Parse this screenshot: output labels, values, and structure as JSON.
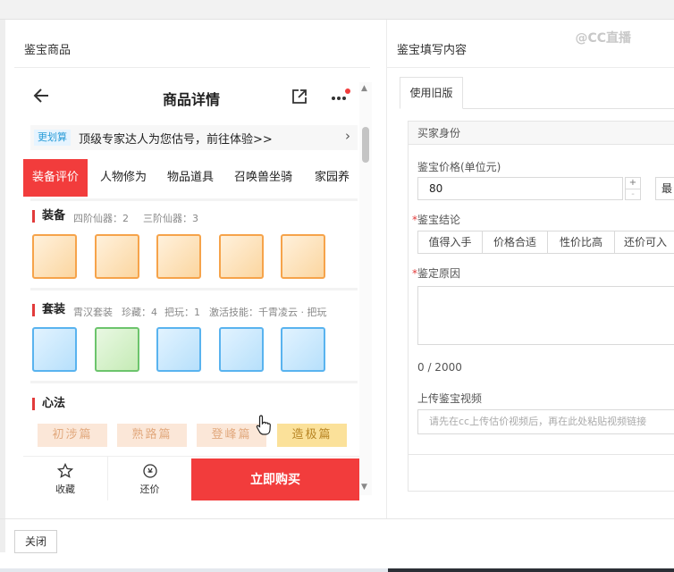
{
  "watermark": "@CC直播",
  "left_panel": {
    "title": "鉴宝商品"
  },
  "right_panel": {
    "title": "鉴宝填写内容"
  },
  "phone": {
    "title": "商品详情",
    "promo": {
      "badge": "更划算",
      "text": "顶级专家达人为您估号，前往体验>>",
      "chevron": "›"
    },
    "tabs": [
      "装备评价",
      "人物修为",
      "物品道具",
      "召唤兽坐骑",
      "家园养"
    ],
    "sections": {
      "equipment": {
        "title": "装备",
        "meta": [
          "四阶仙器：2",
          "三阶仙器：3"
        ]
      },
      "set": {
        "title": "套装",
        "meta": [
          "霄汉套装",
          "珍藏：4",
          "把玩：1",
          "激活技能：千霄凌云 · 把玩"
        ]
      },
      "xinfa": {
        "title": "心法",
        "items": [
          "初涉篇",
          "熟路篇",
          "登峰篇",
          "造极篇"
        ]
      }
    },
    "bottom_bar": {
      "favorite": "收藏",
      "bargain": "还价",
      "buy": "立即购买"
    }
  },
  "form": {
    "tab_label": "使用旧版",
    "section_title": "买家身份",
    "price_label": "鉴宝价格(单位元)",
    "price_value": "80",
    "price_extra": "最",
    "conclusion_label": "鉴宝结论",
    "conclusion_options": [
      "值得入手",
      "价格合适",
      "性价比高",
      "还价可入"
    ],
    "reason_label": "鉴定原因",
    "char_count": "0 / 2000",
    "video_label": "上传鉴宝视频",
    "video_placeholder": "请先在cc上传估价视频后，再在此处粘贴视频链接"
  },
  "footer": {
    "close_label": "关闭"
  },
  "colors": {
    "accent_red": "#f23c3c",
    "orange_border": "#f6a34a",
    "blue_border": "#59b3ef",
    "green_border": "#6cc46c"
  }
}
